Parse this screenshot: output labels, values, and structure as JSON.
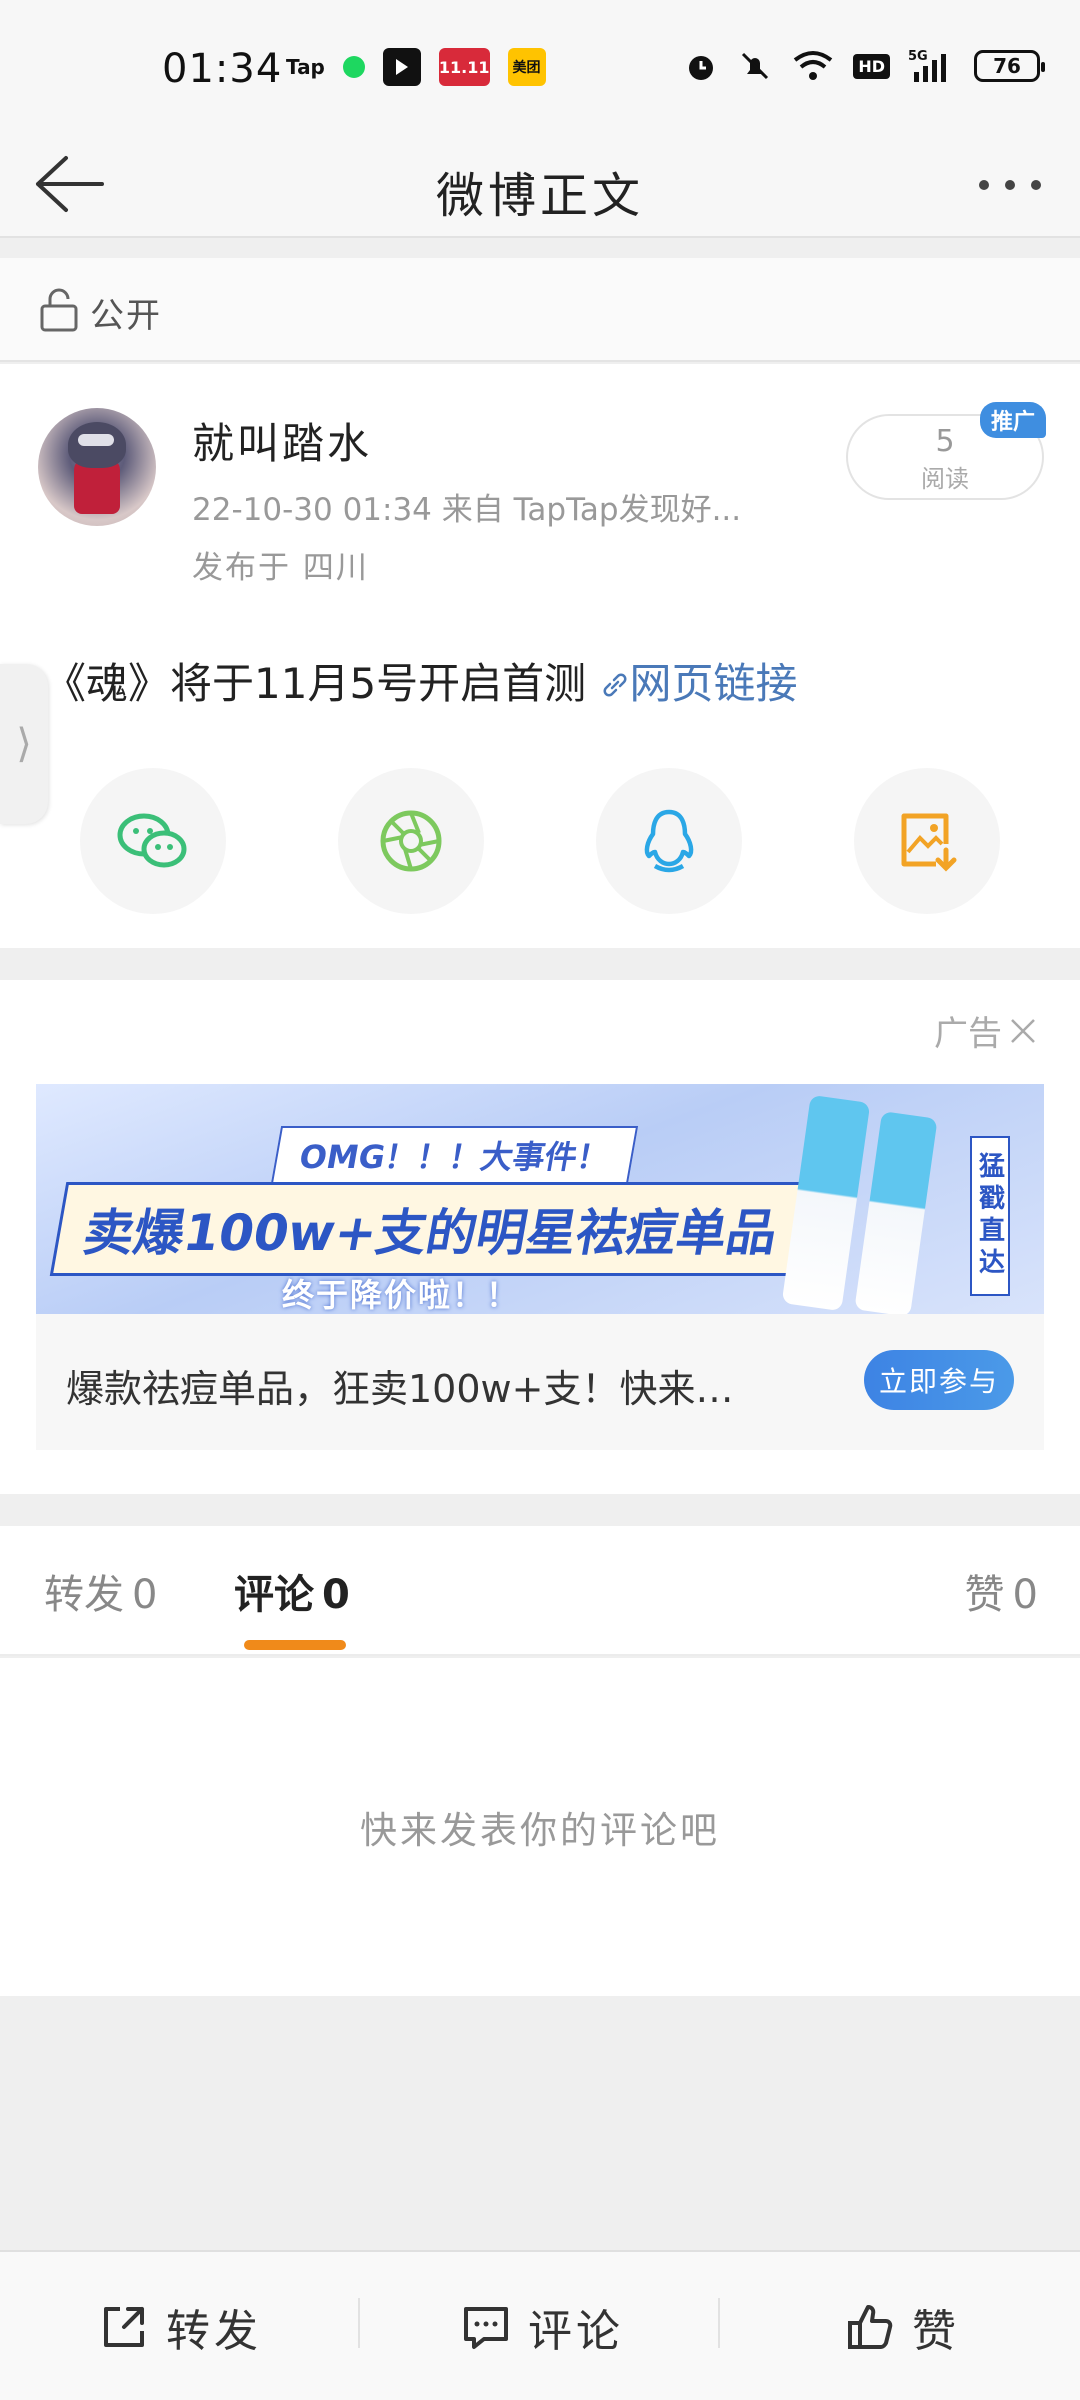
{
  "status_bar": {
    "time": "01:34",
    "apps": [
      "Tap",
      "美团"
    ],
    "battery": "76"
  },
  "nav": {
    "title": "微博正文"
  },
  "visibility": {
    "label": "公开"
  },
  "post": {
    "username": "就叫踏水",
    "meta_line": "22-10-30 01:34  来自 TapTap发现好...",
    "location": "发布于 四川",
    "read_count": "5",
    "read_label": "阅读",
    "promo_badge": "推广",
    "content_text": "《魂》将于11月5号开启首测 ",
    "content_link": "网页链接",
    "share_targets": [
      "wechat-icon",
      "moments-icon",
      "qq-icon",
      "save-image-icon"
    ]
  },
  "ad": {
    "label": "广告",
    "banner_tag": "OMG！！！大事件！",
    "banner_headline": "卖爆100w+支的明星祛痘单品",
    "banner_sub": "终于降价啦！！",
    "banner_side": "猛戳直达",
    "description": "爆款祛痘单品，狂卖100w+支！快来…",
    "cta": "立即参与"
  },
  "tabs": {
    "repost_label": "转发",
    "repost_count": "0",
    "comment_label": "评论",
    "comment_count": "0",
    "like_label": "赞",
    "like_count": "0"
  },
  "comments": {
    "empty_text": "快来发表你的评论吧"
  },
  "bottom_bar": {
    "repost": "转发",
    "comment": "评论",
    "like": "赞"
  },
  "colors": {
    "accent": "#f08a1a",
    "link": "#4a79b8",
    "cta": "#3d83e4"
  }
}
